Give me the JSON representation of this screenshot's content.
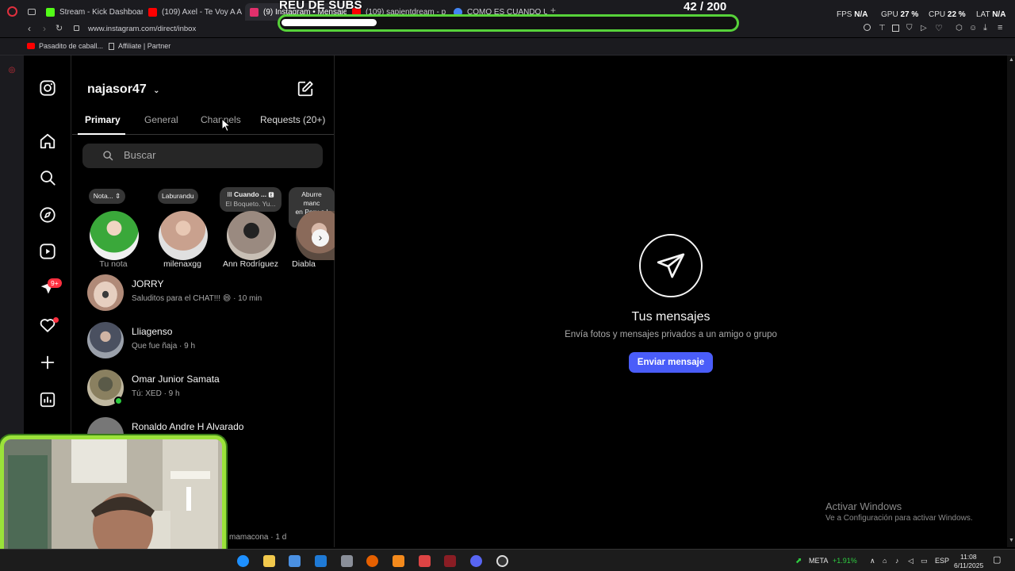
{
  "browser": {
    "tabs": [
      {
        "label": "Stream - Kick Dashboard",
        "color": "#53fc18"
      },
      {
        "label": "(109) Axel - Te Voy A Am",
        "color": "#ff0000"
      },
      {
        "label": "(9) Instagram • Mensajes",
        "color": "#e1306c"
      },
      {
        "label": "(109) sapientdream - pas",
        "color": "#ff0000"
      },
      {
        "label": "COMO ES CUANDO UNA",
        "color": "#4285f4"
      }
    ],
    "url": "www.instagram.com/direct/inbox",
    "bookmarks": [
      "Pasadito de caball...",
      "Affiliate | Partner"
    ],
    "stats": {
      "fps_label": "FPS",
      "fps": "N/A",
      "gpu_label": "GPU",
      "gpu": "27 %",
      "cpu_label": "CPU",
      "cpu": "22 %",
      "lat_label": "LAT",
      "lat": "N/A"
    }
  },
  "overlay": {
    "goal_title": "REU DE SUBS",
    "goal_count": "42",
    "goal_total": "/ 200",
    "goal_progress": 0.21
  },
  "instagram": {
    "username": "najasor47",
    "tabs": [
      "Primary",
      "General",
      "Channels",
      "Requests (20+)"
    ],
    "search_placeholder": "Buscar",
    "notifications_badge": "9+",
    "stories": [
      {
        "note": "Nota...",
        "name": "Tu nota",
        "color": "#3aa83a"
      },
      {
        "note": "Laburandu",
        "name": "milenaxgg",
        "color": "#c9a18e"
      },
      {
        "note_title": "Cuando ...",
        "note_sub": "El Boqueto. Yu...",
        "name": "Ann Rodríguez",
        "color": "#9a8a80"
      },
      {
        "note": "Aburre man en Peru a l firme",
        "note_l1": "Aburre manc",
        "note_l2": "en Peru a l",
        "note_l3": "firme",
        "name": "Diabla",
        "color": "#8a6a5a"
      }
    ],
    "conversations": [
      {
        "name": "JORRY",
        "message": "Saluditos para el CHAT!!! 😄 · 10 min",
        "color": "#c8a89a"
      },
      {
        "name": "Lliagenso",
        "message": "Que fue ñaja · 9 h",
        "color": "#6a7080"
      },
      {
        "name": "Omar Junior Samata",
        "message": "Tú: XED · 9 h",
        "color": "#8a8060"
      },
      {
        "name": "Ronaldo Andre H Alvarado",
        "message": "",
        "color": "#777777"
      }
    ],
    "partial_conv": "mamacona · 1 d",
    "empty": {
      "title": "Tus mensajes",
      "subtitle": "Envía fotos y mensajes privados a un amigo o grupo",
      "button": "Enviar mensaje"
    }
  },
  "windows": {
    "activate_title": "Activar Windows",
    "activate_sub": "Ve a Configuración para activar Windows.",
    "stock": "META",
    "stock_change": "+1.91%",
    "lang": "ESP",
    "time": "11:08",
    "date": "6/11/2025"
  }
}
